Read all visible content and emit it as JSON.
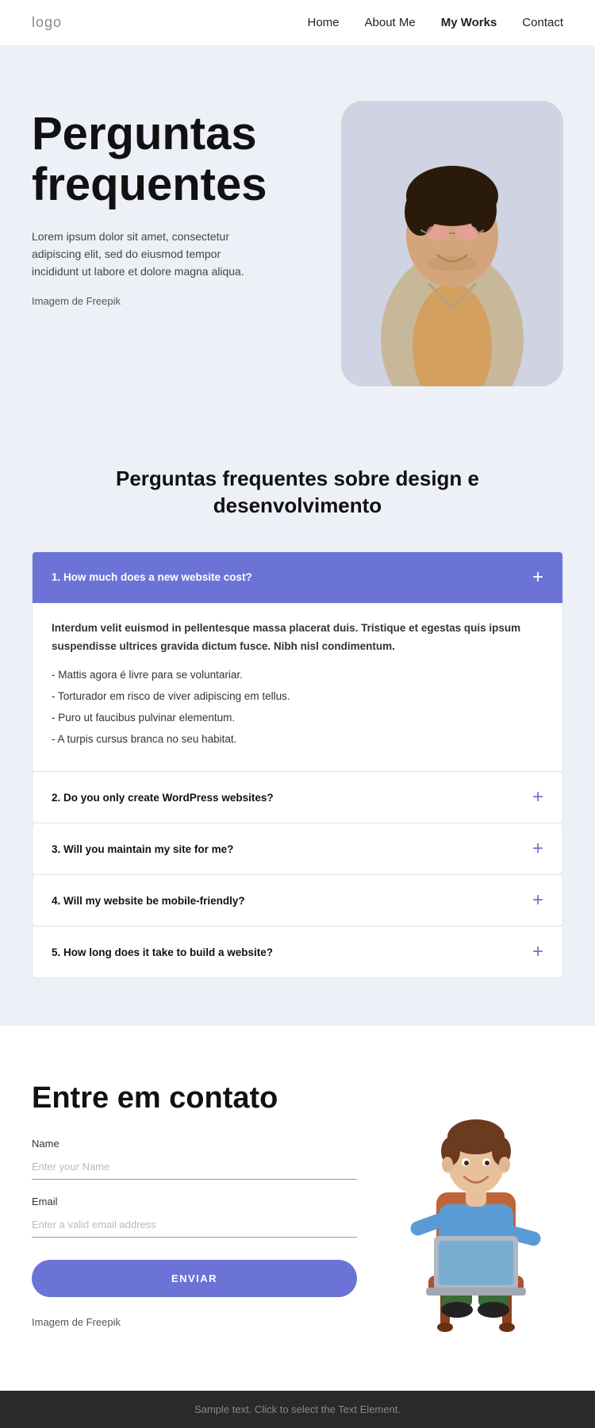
{
  "nav": {
    "logo": "logo",
    "links": [
      {
        "label": "Home",
        "active": false
      },
      {
        "label": "About Me",
        "active": false
      },
      {
        "label": "My Works",
        "active": true
      },
      {
        "label": "Contact",
        "active": false
      }
    ]
  },
  "hero": {
    "title": "Perguntas frequentes",
    "description": "Lorem ipsum dolor sit amet, consectetur adipiscing elit, sed do eiusmod tempor incididunt ut labore et dolore magna aliqua.",
    "credit_prefix": "Imagem de ",
    "credit_link": "Freepik"
  },
  "faq": {
    "subtitle": "Perguntas frequentes sobre design e desenvolvimento",
    "items": [
      {
        "question": "1. How much does a new website cost?",
        "open": true,
        "answer_bold": "Interdum velit euismod in pellentesque massa placerat duis. Tristique et egestas quis ipsum suspendisse ultrices gravida dictum fusce. Nibh nisl condimentum.",
        "answer_list": [
          "Mattis agora é livre para se voluntariar.",
          "Torturador em risco de viver adipiscing em tellus.",
          "Puro ut faucibus pulvinar elementum.",
          "A turpis cursus branca no seu habitat."
        ]
      },
      {
        "question": "2. Do you only create WordPress websites?",
        "open": false
      },
      {
        "question": "3. Will you maintain my site for me?",
        "open": false
      },
      {
        "question": "4. Will my website be mobile-friendly?",
        "open": false
      },
      {
        "question": "5. How long does it take to build a website?",
        "open": false
      }
    ]
  },
  "contact": {
    "title": "Entre em contato",
    "name_label": "Name",
    "name_placeholder": "Enter your Name",
    "email_label": "Email",
    "email_placeholder": "Enter a valid email address",
    "submit_label": "ENVIAR",
    "credit_prefix": "Imagem de ",
    "credit_link": "Freepik"
  },
  "footer": {
    "text": "Sample text. Click to select the Text Element."
  }
}
